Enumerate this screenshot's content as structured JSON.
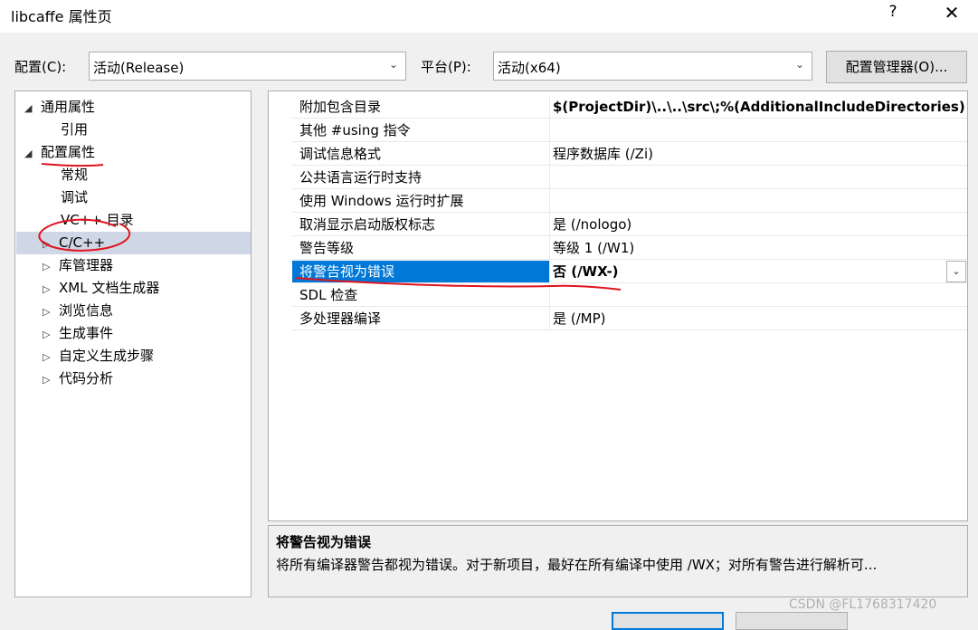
{
  "window": {
    "title": "libcaffe 属性页",
    "help_label": "?",
    "close_label": "✕"
  },
  "config_row": {
    "config_label": "配置(C):",
    "config_value": "活动(Release)",
    "platform_label": "平台(P):",
    "platform_value": "活动(x64)",
    "manager_button": "配置管理器(O)..."
  },
  "tree": {
    "items": [
      {
        "label": "通用属性",
        "expander": "◢"
      },
      {
        "label": "引用",
        "expander": ""
      },
      {
        "label": "配置属性",
        "expander": "◢"
      },
      {
        "label": "常规",
        "expander": ""
      },
      {
        "label": "调试",
        "expander": ""
      },
      {
        "label": "VC++ 目录",
        "expander": ""
      },
      {
        "label": "C/C++",
        "expander": "▷"
      },
      {
        "label": "库管理器",
        "expander": "▷"
      },
      {
        "label": "XML 文档生成器",
        "expander": "▷"
      },
      {
        "label": "浏览信息",
        "expander": "▷"
      },
      {
        "label": "生成事件",
        "expander": "▷"
      },
      {
        "label": "自定义生成步骤",
        "expander": "▷"
      },
      {
        "label": "代码分析",
        "expander": "▷"
      }
    ]
  },
  "grid": {
    "rows": [
      {
        "name": "附加包含目录",
        "value": "$(ProjectDir)\\..\\..\\src\\;%(AdditionalIncludeDirectories)"
      },
      {
        "name": "其他 #using 指令",
        "value": ""
      },
      {
        "name": "调试信息格式",
        "value": "程序数据库 (/Zi)"
      },
      {
        "name": "公共语言运行时支持",
        "value": ""
      },
      {
        "name": "使用 Windows 运行时扩展",
        "value": ""
      },
      {
        "name": "取消显示启动版权标志",
        "value": "是 (/nologo)"
      },
      {
        "name": "警告等级",
        "value": "等级 1 (/W1)"
      },
      {
        "name": "将警告视为错误",
        "value": "否 (/WX-)"
      },
      {
        "name": "SDL 检查",
        "value": ""
      },
      {
        "name": "多处理器编译",
        "value": "是 (/MP)"
      }
    ]
  },
  "description": {
    "title": "将警告视为错误",
    "text": "将所有编译器警告都视为错误。对于新项目，最好在所有编译中使用 /WX；对所有警告进行解析可..."
  },
  "watermark": "CSDN @FL1768317420",
  "colors": {
    "selection": "#0078d7",
    "ink": "#e0141e"
  }
}
